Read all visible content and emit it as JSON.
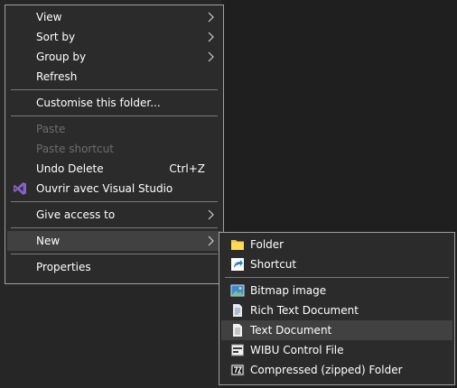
{
  "main_menu": {
    "view": "View",
    "sort_by": "Sort by",
    "group_by": "Group by",
    "refresh": "Refresh",
    "customise": "Customise this folder...",
    "paste": "Paste",
    "paste_shortcut": "Paste shortcut",
    "undo_delete": "Undo Delete",
    "undo_shortcut": "Ctrl+Z",
    "open_visual_studio": "Ouvrir avec Visual Studio",
    "give_access": "Give access to",
    "new": "New",
    "properties": "Properties"
  },
  "new_submenu": {
    "folder": "Folder",
    "shortcut": "Shortcut",
    "bitmap": "Bitmap image",
    "rtf": "Rich Text Document",
    "text": "Text Document",
    "wibu": "WIBU Control File",
    "zip": "Compressed (zipped) Folder"
  },
  "colors": {
    "menu_bg": "#2b2b2b",
    "highlight": "#414141",
    "disabled_text": "#6d6d6d",
    "vs_purple": "#8661c5",
    "folder_yellow": "#f5c542"
  }
}
